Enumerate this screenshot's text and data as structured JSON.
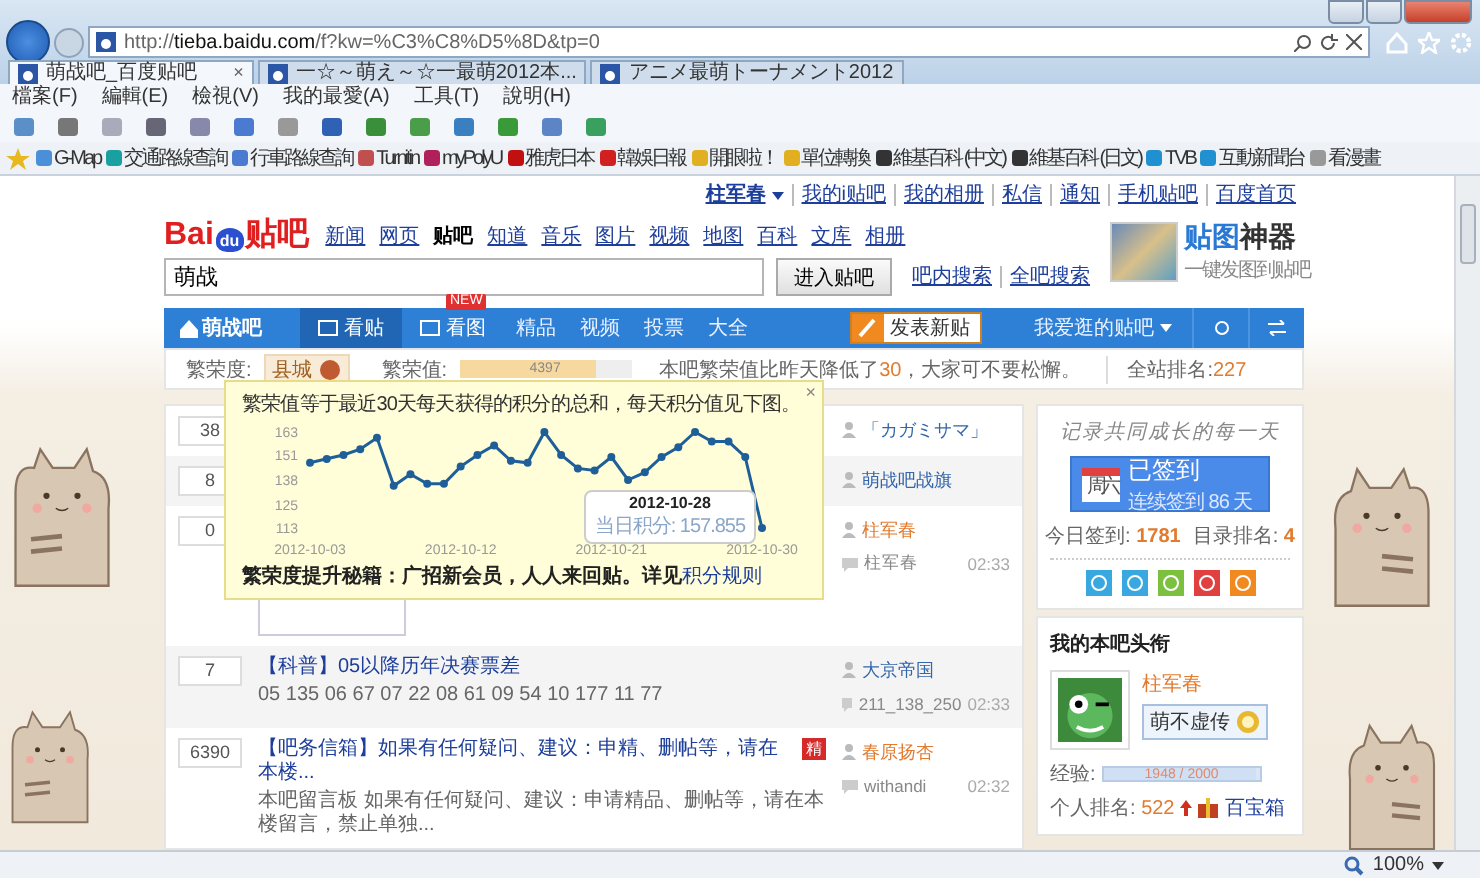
{
  "browser": {
    "address": "http://tieba.baidu.com/f?kw=%C3%C8%D5%8D&tp=0",
    "tabs": [
      {
        "title": "萌战吧_百度贴吧",
        "selected": true,
        "close": "×"
      },
      {
        "title": "一☆～萌え～☆一最萌2012本...",
        "selected": false
      },
      {
        "title": "アニメ最萌トーナメント2012",
        "selected": false
      }
    ],
    "menu": [
      "檔案(F)",
      "編輯(E)",
      "檢視(V)",
      "我的最愛(A)",
      "工具(T)",
      "說明(H)"
    ],
    "favorites": [
      "G-Map",
      "交通路線查詢",
      "行車路線查詢",
      "Turnitin",
      "myPolyU",
      "雅虎日本",
      "韓娛日報",
      "開眼啦！",
      "單位轉換",
      "維基百科 (中文)",
      "維基百科 (日文)",
      "TVB",
      "互動新聞台",
      "看漫畫"
    ]
  },
  "page": {
    "user": "柱军春",
    "top_links": [
      "我的i贴吧",
      "我的相册",
      "私信",
      "通知",
      "手机贴吧",
      "百度首页"
    ],
    "nav": [
      {
        "label": "新闻",
        "selected": false
      },
      {
        "label": "网页",
        "selected": false
      },
      {
        "label": "贴吧",
        "selected": true
      },
      {
        "label": "知道",
        "selected": false
      },
      {
        "label": "音乐",
        "selected": false
      },
      {
        "label": "图片",
        "selected": false
      },
      {
        "label": "视频",
        "selected": false
      },
      {
        "label": "地图",
        "selected": false
      },
      {
        "label": "百科",
        "selected": false
      },
      {
        "label": "文库",
        "selected": false
      },
      {
        "label": "相册",
        "selected": false
      }
    ],
    "logo": {
      "brand_left": "Bai",
      "brand_paw": "du",
      "brand_right": "贴吧"
    },
    "search": {
      "value": "萌战",
      "button": "进入贴吧",
      "links": [
        "吧内搜索",
        "全吧搜索"
      ]
    },
    "ad": {
      "title_a": "贴图",
      "title_b": "神器",
      "subtitle": "一键发图到贴吧"
    },
    "forum_bar": {
      "name": "萌战吧",
      "tabs": [
        {
          "label": "看贴",
          "kind": "tab",
          "selected": true
        },
        {
          "label": "看图",
          "kind": "tab",
          "selected": false,
          "badge": "NEW"
        },
        {
          "label": "精品",
          "kind": "link",
          "selected": false
        },
        {
          "label": "视频",
          "kind": "link",
          "selected": false
        },
        {
          "label": "投票",
          "kind": "link",
          "selected": false
        },
        {
          "label": "大全",
          "kind": "link",
          "selected": false
        }
      ],
      "post_button": "发表新贴",
      "favorites_menu": "我爱逛的贴吧"
    },
    "stats": {
      "degree_label": "繁荣度:",
      "degree": "县城",
      "value_label": "繁荣值:",
      "value": "4397",
      "level": 0.8,
      "notice": "本吧繁荣值比昨天降低了",
      "notice_change": "30",
      "notice_end": "，大家可不要松懈。",
      "rank_label": "全站排名:",
      "rank": "227"
    },
    "popup": {
      "text": "繁荣值等于最近30天每天获得的积分的总和，每天积分值见下图。",
      "close": "×",
      "chart_data": {
        "type": "line",
        "categories": [
          "2012-10-03",
          null,
          null,
          null,
          null,
          null,
          null,
          null,
          null,
          "2012-10-12",
          null,
          null,
          null,
          null,
          null,
          null,
          null,
          null,
          "2012-10-21",
          null,
          null,
          null,
          null,
          null,
          null,
          null,
          null,
          "2012-10-30"
        ],
        "series": [
          {
            "color": "#1f5f99",
            "marker": "circle",
            "values": [
              147,
              149,
              151,
              154,
              160,
              135,
              141,
              136,
              136,
              145,
              151,
              156,
              148,
              147,
              163,
              151,
              144,
              143,
              150,
              138,
              142,
              150,
              155,
              163,
              158,
              158,
              150,
              113
            ]
          }
        ],
        "ylim": [
          113,
          163
        ],
        "yticks": [
          113,
          125,
          138,
          151,
          163
        ]
      },
      "chart_tooltip": {
        "date": "2012-10-28",
        "text": "当日积分: 157.855"
      },
      "tip": "繁荣度提升秘籍：广招新会员，人人来回贴。详见",
      "tip_link": "积分规则"
    },
    "posts": [
      {
        "replies": "38",
        "author": "「カガミサマ」",
        "color": "#3366aa"
      },
      {
        "replies": "8",
        "author": "萌战吧战旗",
        "color": "#3366aa"
      },
      {
        "replies": "0",
        "author": "柱军春",
        "color": "#e07b30",
        "last_reply": "柱军春",
        "time": "02:33",
        "has_image": true
      },
      {
        "replies": "7",
        "title": "【科普】05以降历年决赛票差",
        "excerpt": "05 135 06 67 07 22 08 61 09 54 10 177 11 77",
        "author": "大京帝国",
        "color": "#3366aa",
        "last_reply": "211_138_250",
        "time": "02:33"
      },
      {
        "replies": "6390",
        "title": "【吧务信箱】如果有任何疑问、建议：申精、删帖等，请在本楼...",
        "tag": "精",
        "excerpt": "本吧留言板 如果有任何疑问、建议：申请精品、删帖等，请在本楼留言，禁止单独...",
        "author": "春原扬杏",
        "color": "#e07b30",
        "last_reply": "withandi",
        "time": "02:32"
      }
    ],
    "sidebar": {
      "motto": "记录共同成长的每一天",
      "sign_status": "已签到",
      "sign_streak": "连续签到 86 天",
      "calendar_day": "周六",
      "today_label": "今日签到:",
      "today": "1781",
      "rank_label": "目录排名:",
      "rank": "4",
      "title_card": {
        "heading": "我的本吧头衔",
        "name": "柱军春",
        "title": "萌不虚传",
        "exp_label": "经验:",
        "exp": "1948 / 2000",
        "level": 0.974,
        "rank_label": "个人排名:",
        "rank": "522",
        "treasure": "百宝箱"
      }
    }
  },
  "status_bar": {
    "zoom": "100%"
  }
}
